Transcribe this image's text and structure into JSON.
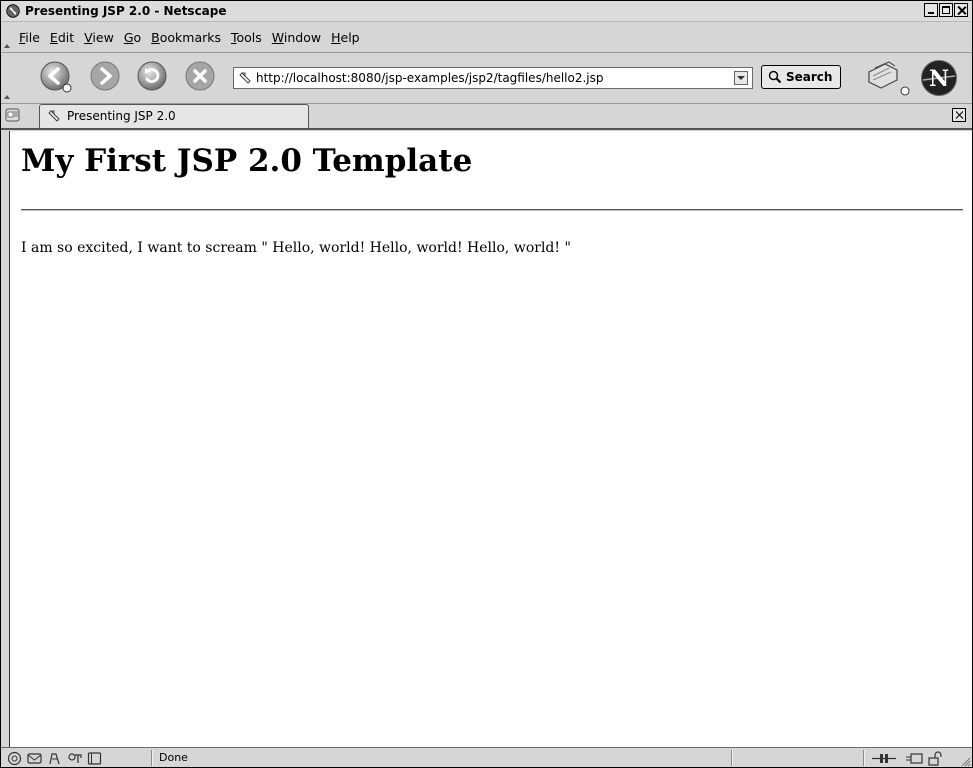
{
  "window": {
    "title": "Presenting JSP 2.0 - Netscape"
  },
  "menu": {
    "items": [
      {
        "accel": "F",
        "rest": "ile"
      },
      {
        "accel": "E",
        "rest": "dit"
      },
      {
        "accel": "V",
        "rest": "iew"
      },
      {
        "accel": "G",
        "rest": "o"
      },
      {
        "accel": "B",
        "rest": "ookmarks"
      },
      {
        "accel": "T",
        "rest": "ools"
      },
      {
        "accel": "W",
        "rest": "indow"
      },
      {
        "accel": "H",
        "rest": "elp"
      }
    ]
  },
  "toolbar": {
    "url": "http://localhost:8080/jsp-examples/jsp2/tagfiles/hello2.jsp",
    "search_label": "Search",
    "icons": [
      "back-icon",
      "forward-icon",
      "reload-icon",
      "stop-icon",
      "print-icon",
      "netscape-logo-icon"
    ]
  },
  "tabs": {
    "active_label": "Presenting JSP 2.0"
  },
  "page": {
    "heading": "My First JSP 2.0 Template",
    "body": "I am so excited, I want to scream \" Hello, world! Hello, world! Hello, world! \""
  },
  "status": {
    "text": "Done"
  }
}
